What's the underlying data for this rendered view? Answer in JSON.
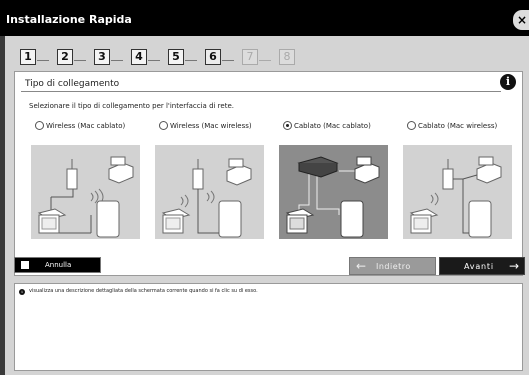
{
  "window": {
    "title": "Installazione Rapida",
    "close_label": "×"
  },
  "steps": [
    {
      "number": "1",
      "state": "done"
    },
    {
      "number": "2",
      "state": "done"
    },
    {
      "number": "3",
      "state": "done"
    },
    {
      "number": "4",
      "state": "done"
    },
    {
      "number": "5",
      "state": "done"
    },
    {
      "number": "6",
      "state": "active"
    },
    {
      "number": "7",
      "state": "disabled"
    },
    {
      "number": "8",
      "state": "disabled"
    }
  ],
  "panel": {
    "title": "Tipo di collegamento",
    "info_icon": "info-icon",
    "instruction": "Selezionare il tipo di collegamento per l'interfaccia di rete."
  },
  "options": [
    {
      "label": "Wireless (Mac cablato)",
      "checked": false
    },
    {
      "label": "Wireless (Mac wireless)",
      "checked": false
    },
    {
      "label": "Cablato (Mac cablato)",
      "checked": true
    },
    {
      "label": "Cablato (Mac wireless)",
      "checked": false
    }
  ],
  "buttons": {
    "cancel": "Annulla",
    "back": "Indietro",
    "next": "Avanti"
  },
  "description": {
    "text": "visualizza una descrizione dettagliata della schermata corrente quando si fa clic su di esso."
  }
}
